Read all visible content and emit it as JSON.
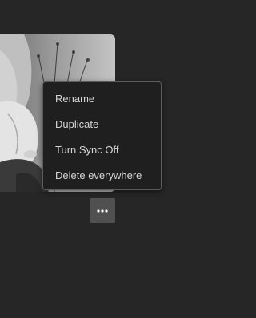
{
  "thumbnail": {
    "description_icon": "photo-thumbnail"
  },
  "context_menu": {
    "items": [
      {
        "label": "Rename"
      },
      {
        "label": "Duplicate"
      },
      {
        "label": "Turn Sync Off"
      },
      {
        "label": "Delete everywhere"
      }
    ]
  },
  "more_button": {
    "icon": "ellipsis-icon"
  },
  "colors": {
    "background": "#262626",
    "menu_background": "#1f1f1f",
    "menu_border": "#5c5c5c",
    "menu_text": "#d6d6d6",
    "button_background": "#505050"
  }
}
